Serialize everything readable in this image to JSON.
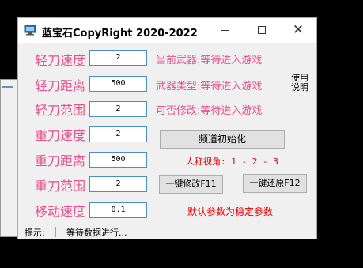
{
  "window": {
    "title": "蓝宝石CopyRight 2020-2022",
    "close_glyph": "✕"
  },
  "params": [
    {
      "label": "轻刀速度",
      "value": "2"
    },
    {
      "label": "轻刀距离",
      "value": "500"
    },
    {
      "label": "轻刀范围",
      "value": "2"
    },
    {
      "label": "重刀速度",
      "value": "2"
    },
    {
      "label": "重刀距离",
      "value": "500"
    },
    {
      "label": "重刀范围",
      "value": "2"
    },
    {
      "label": "移动速度",
      "value": "0.1"
    }
  ],
  "info": {
    "current_weapon": "当前武器:等待进入游戏",
    "weapon_type": "武器类型:等待进入游戏",
    "modifiable": "可否修改:等待进入游戏"
  },
  "help": {
    "line1": "使用",
    "line2": "说明"
  },
  "buttons": {
    "channel_init": "频道初始化",
    "one_click_modify": "一键修改F11",
    "one_click_restore": "一键还原F12"
  },
  "view_text": "人称视角: 1 - 2 - 3",
  "default_note": "默认参数为稳定参数",
  "status": {
    "label": "提示:",
    "text": "等待数据进行..."
  },
  "colors": {
    "label_pink": "#e6508c",
    "warning_red": "#e60000",
    "field_border": "#4a8fbf"
  },
  "icons": {
    "app": "monitor-icon",
    "minimize": "minimize-icon",
    "maximize": "maximize-icon",
    "close": "close-icon"
  }
}
